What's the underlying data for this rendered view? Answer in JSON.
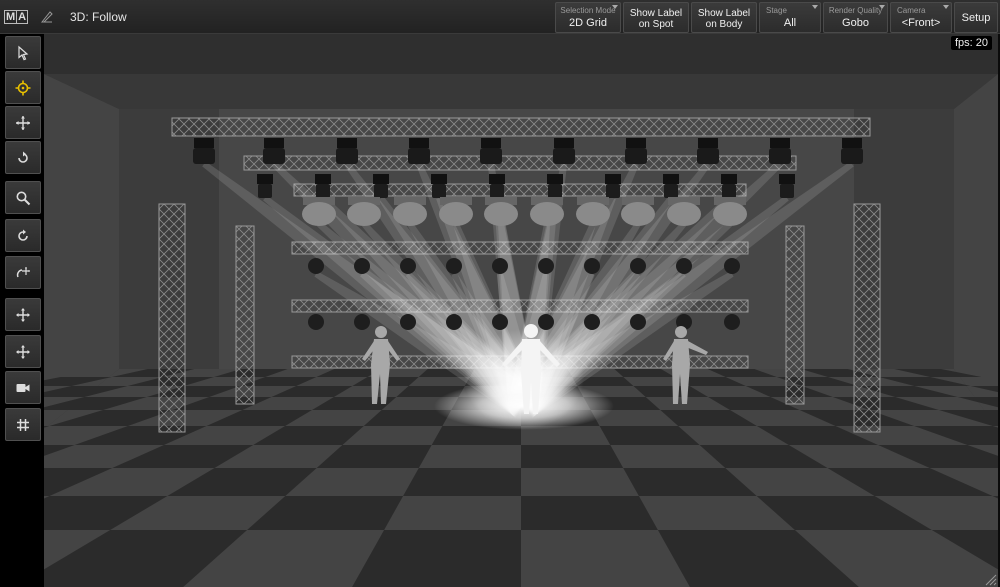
{
  "app": {
    "logo_left": "M",
    "logo_right": "A",
    "window_title": "3D: Follow"
  },
  "titlebar": {
    "selection_mode": {
      "label": "Selection Mode",
      "value": "2D Grid"
    },
    "show_label_spot": {
      "line1": "Show Label",
      "line2": "on Spot"
    },
    "show_label_body": {
      "line1": "Show Label",
      "line2": "on Body"
    },
    "stage": {
      "label": "Stage",
      "value": "All"
    },
    "render_quality": {
      "label": "Render Quality",
      "value": "Gobo"
    },
    "camera": {
      "label": "Camera",
      "value": "<Front>"
    },
    "setup": "Setup"
  },
  "toolbar": {
    "tools": [
      {
        "name": "select-arrow-icon",
        "active": false
      },
      {
        "name": "crosshair-target-icon",
        "active": true
      },
      {
        "name": "move-icon",
        "active": false
      },
      {
        "name": "rotate-icon",
        "active": false
      },
      {
        "name": "zoom-icon",
        "active": false
      },
      {
        "name": "orbit-icon",
        "active": false
      },
      {
        "name": "rotate-move-icon",
        "active": false
      },
      {
        "name": "move-xy-icon",
        "active": false
      },
      {
        "name": "move-xyz-icon",
        "active": false
      },
      {
        "name": "camera-icon",
        "active": false
      },
      {
        "name": "grid-icon",
        "active": false
      }
    ]
  },
  "viewport": {
    "fps_label": "fps: 20"
  },
  "colors": {
    "accent_active": "#e8c000",
    "titlebar_bg": "#2a2a2a",
    "beam": "#ffffff"
  }
}
